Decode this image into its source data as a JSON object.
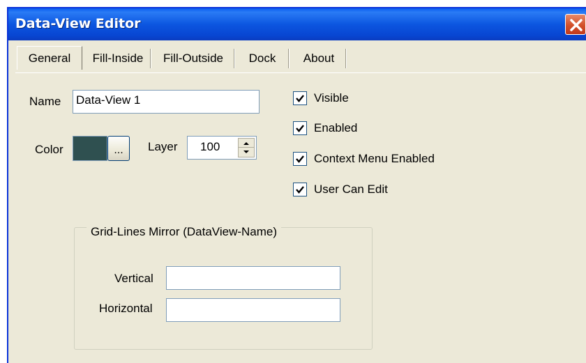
{
  "window": {
    "title": "Data-View Editor",
    "close_glyph": "✕"
  },
  "tabs": [
    {
      "label": "General",
      "active": true
    },
    {
      "label": "Fill-Inside",
      "active": false
    },
    {
      "label": "Fill-Outside",
      "active": false
    },
    {
      "label": "Dock",
      "active": false
    },
    {
      "label": "About",
      "active": false
    }
  ],
  "general": {
    "name_label": "Name",
    "name_value": "Data-View 1",
    "color_label": "Color",
    "color_value": "#2f5050",
    "color_button_label": "...",
    "layer_label": "Layer",
    "layer_value": "100",
    "checkboxes": [
      {
        "label": "Visible",
        "checked": true
      },
      {
        "label": "Enabled",
        "checked": true
      },
      {
        "label": "Context Menu Enabled",
        "checked": true
      },
      {
        "label": "User Can Edit",
        "checked": true
      }
    ],
    "grid_mirror": {
      "title": "Grid-Lines  Mirror (DataView-Name)",
      "vertical_label": "Vertical",
      "vertical_value": "",
      "horizontal_label": "Horizontal",
      "horizontal_value": ""
    }
  },
  "colors": {
    "titlebar": "#0a56e0",
    "dialog_bg": "#ece9d8",
    "close_button": "#d2502a"
  }
}
